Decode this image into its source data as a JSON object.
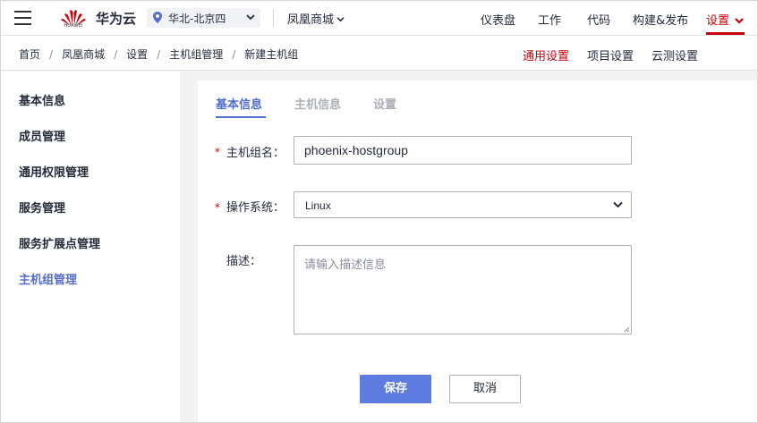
{
  "topbar": {
    "brand_logo_text": "HUAWEI",
    "brand": "华为云",
    "region": "华北-北京四",
    "project": "凤凰商城",
    "nav": [
      "仪表盘",
      "工作",
      "代码",
      "构建&发布",
      "设置"
    ],
    "active_nav": "设置",
    "accent_color": "#c7000b"
  },
  "breadcrumb": {
    "items": [
      "首页",
      "凤凰商城",
      "设置",
      "主机组管理",
      "新建主机组"
    ],
    "sublinks": [
      "通用设置",
      "项目设置",
      "云测设置"
    ],
    "active_sublink": "通用设置"
  },
  "sidebar": {
    "items": [
      "基本信息",
      "成员管理",
      "通用权限管理",
      "服务管理",
      "服务扩展点管理",
      "主机组管理"
    ],
    "active_item": "主机组管理"
  },
  "form": {
    "tabs": [
      "基本信息",
      "主机信息",
      "设置"
    ],
    "active_tab": "基本信息",
    "required_mark": "*",
    "name_label": "主机组名：",
    "name_value": "phoenix-hostgroup",
    "os_label": "操作系统：",
    "os_value": "Linux",
    "desc_label": "描述：",
    "desc_placeholder": "请输入描述信息",
    "save_label": "保存",
    "cancel_label": "取消",
    "primary_color": "#5e7ce0"
  }
}
